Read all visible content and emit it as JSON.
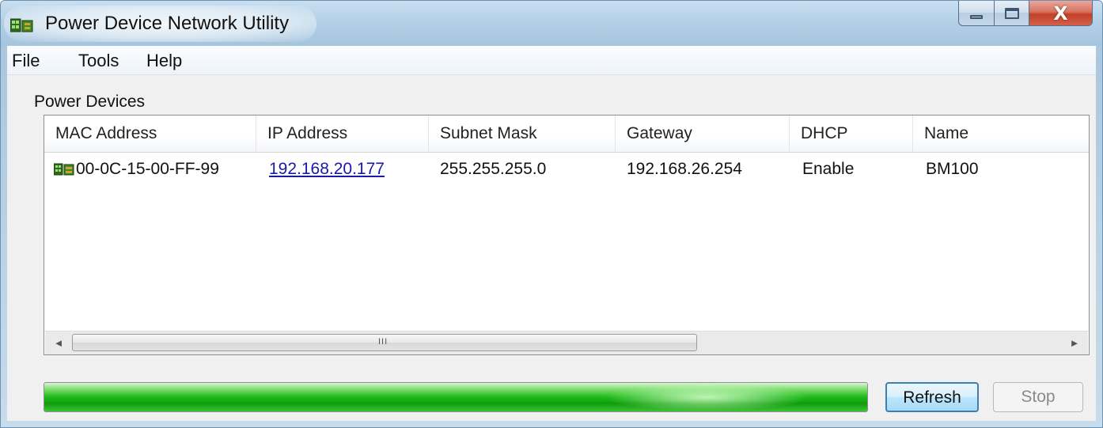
{
  "window": {
    "title": "Power Device Network Utility",
    "controls": {
      "minimize": "minimize",
      "maximize": "maximize",
      "close_glyph": "X"
    }
  },
  "menu": {
    "items": [
      {
        "label": "File"
      },
      {
        "label": "Tools"
      },
      {
        "label": "Help"
      }
    ]
  },
  "group_label": "Power Devices",
  "table": {
    "columns": [
      "MAC Address",
      "IP Address",
      "Subnet Mask",
      "Gateway",
      "DHCP",
      "Name"
    ],
    "rows": [
      {
        "mac": "00-0C-15-00-FF-99",
        "ip": "192.168.20.177",
        "subnet": "255.255.255.0",
        "gateway": "192.168.26.254",
        "dhcp": "Enable",
        "name": "BM100",
        "icon": "network-device-icon"
      }
    ]
  },
  "scrollbar": {
    "left_arrow": "◄",
    "right_arrow": "►",
    "grip": "III"
  },
  "progress": {
    "percent": 100,
    "color": "#1eb91a"
  },
  "buttons": {
    "refresh": "Refresh",
    "stop": "Stop"
  },
  "colors": {
    "link": "#1a1aa6",
    "accent": "#3c7fb1"
  }
}
